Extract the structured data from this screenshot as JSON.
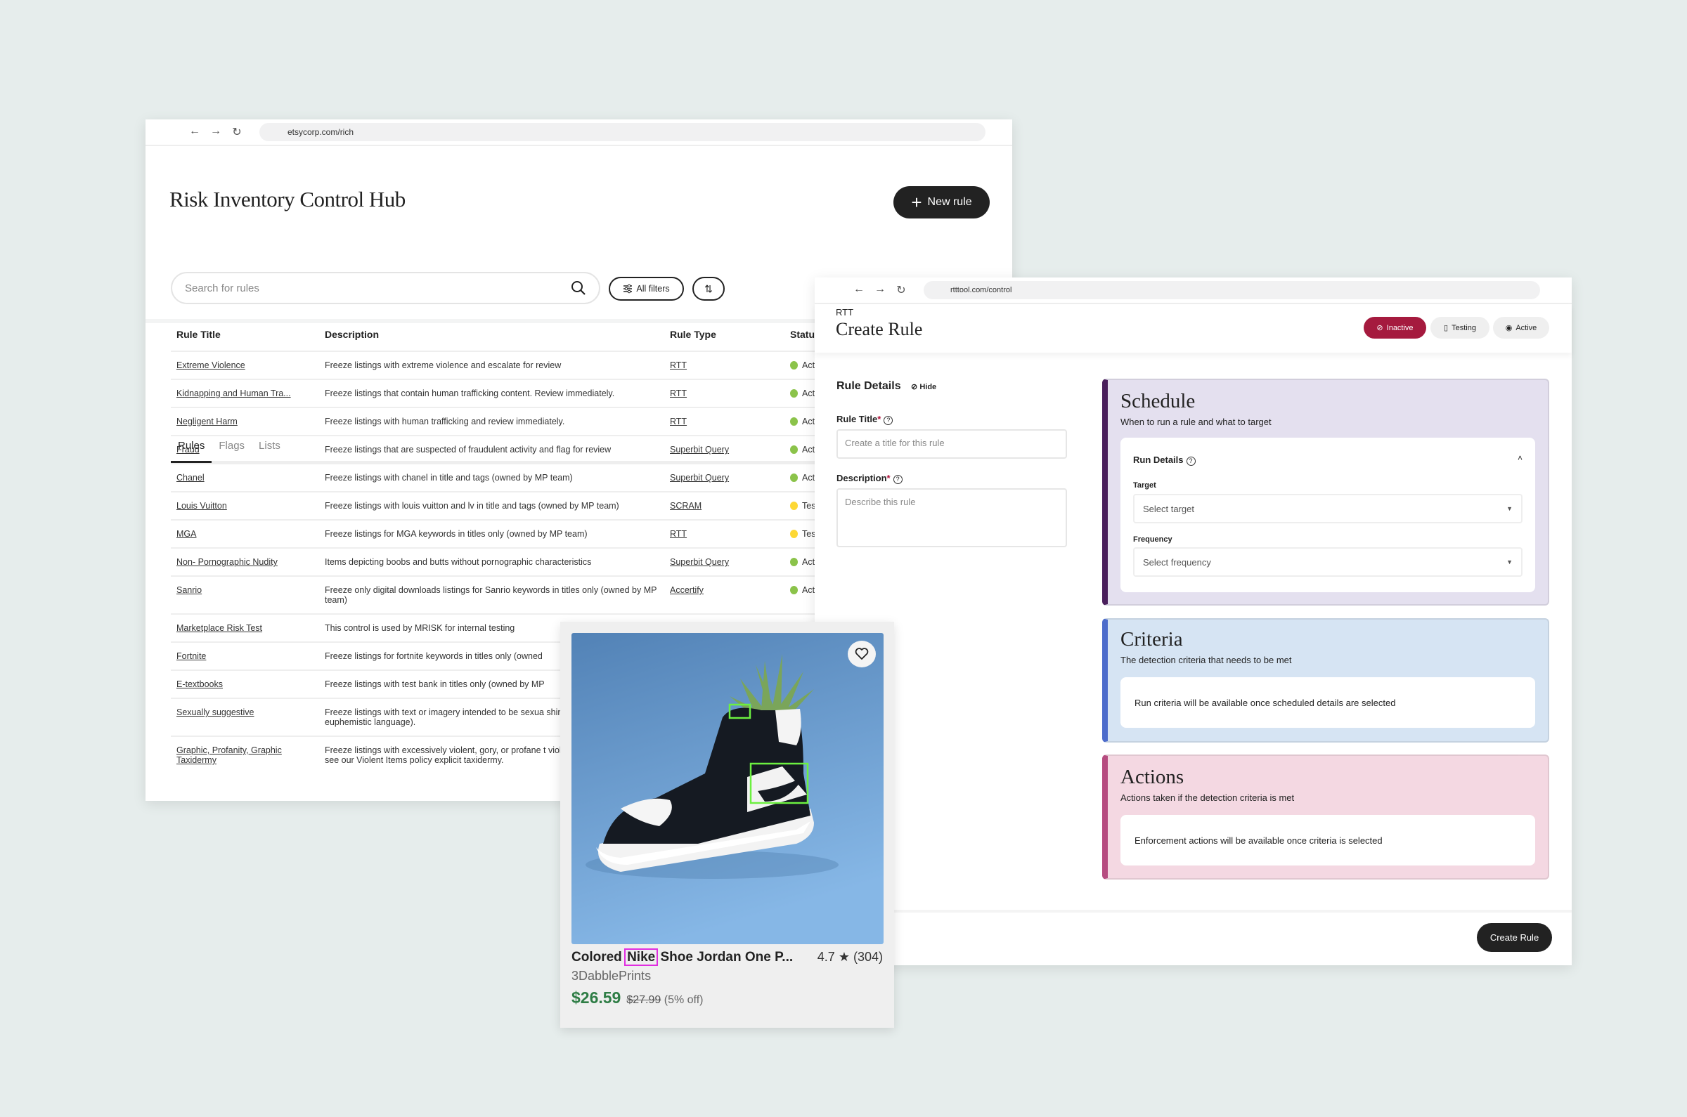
{
  "hub": {
    "url": "etsycorp.com/rich",
    "title": "Risk Inventory Control Hub",
    "new_rule_label": "New rule",
    "tabs": [
      {
        "label": "Rules",
        "active": true
      },
      {
        "label": "Flags",
        "active": false
      },
      {
        "label": "Lists",
        "active": false
      }
    ],
    "search_placeholder": "Search for rules",
    "all_filters_label": "All filters",
    "columns": [
      "Rule Title",
      "Description",
      "Rule Type",
      "Status"
    ],
    "status_colors": {
      "Active": "#8bc34a",
      "Testing": "#fdd835"
    },
    "rows": [
      {
        "title": "Extreme Violence",
        "description": "Freeze listings with extreme violence and escalate for review",
        "type": "RTT",
        "status": "Active"
      },
      {
        "title": "Kidnapping and Human Tra...",
        "description": "Freeze listings that contain human trafficking content. Review immediately.",
        "type": "RTT",
        "status": "Active"
      },
      {
        "title": "Negligent Harm",
        "description": "Freeze listings with human trafficking and review immediately.",
        "type": "RTT",
        "status": "Active"
      },
      {
        "title": "Fraud",
        "description": "Freeze listings that are suspected of fraudulent activity and flag for review",
        "type": "Superbit Query",
        "status": "Active"
      },
      {
        "title": "Chanel",
        "description": "Freeze listings with chanel in title and tags (owned by MP team)",
        "type": "Superbit Query",
        "status": "Active"
      },
      {
        "title": "Louis Vuitton",
        "description": "Freeze listings with louis vuitton and lv in title and tags (owned by MP team)",
        "type": "SCRAM",
        "status": "Testing"
      },
      {
        "title": "MGA",
        "description": "Freeze listings for MGA keywords in titles only (owned by MP team)",
        "type": "RTT",
        "status": "Testing"
      },
      {
        "title": "Non- Pornographic Nudity",
        "description": "Items depicting boobs and butts without pornographic characteristics",
        "type": "Superbit Query",
        "status": "Active"
      },
      {
        "title": "Sanrio",
        "description": "Freeze only digital downloads listings for Sanrio keywords in titles only (owned by MP team)",
        "type": "Accertify",
        "status": "Active"
      },
      {
        "title": "Marketplace Risk Test",
        "description": "This control is used by MRISK for internal testing",
        "type": "",
        "status": ""
      },
      {
        "title": "Fortnite",
        "description": "Freeze listings for fortnite keywords in titles only (owned",
        "type": "",
        "status": ""
      },
      {
        "title": "E-textbooks",
        "description": "Freeze listings with test bank in titles only (owned by MP",
        "type": "",
        "status": ""
      },
      {
        "title": "Sexually suggestive",
        "description": "Freeze listings with text or imagery intended to be sexua shirt with sexually euphemistic language).",
        "type": "",
        "status": ""
      },
      {
        "title": "Graphic, Profanity, Graphic Taxidermy",
        "description": "Freeze listings with excessively violent, gory, or profane t violent items are prohibited - see our Violent Items policy explicit taxidermy.",
        "type": "",
        "status": ""
      }
    ]
  },
  "rtt": {
    "url": "rtttool.com/control",
    "eyebrow": "RTT",
    "title": "Create Rule",
    "status_options": [
      {
        "label": "Inactive",
        "selected": true,
        "icon": "eye-off-icon"
      },
      {
        "label": "Testing",
        "selected": false,
        "icon": "beaker-icon"
      },
      {
        "label": "Active",
        "selected": false,
        "icon": "eye-icon"
      }
    ],
    "accent": "#a51a3e",
    "rule_details": {
      "heading": "Rule Details",
      "hide_label": "Hide",
      "rule_title_label": "Rule Title",
      "rule_title_placeholder": "Create a title for this rule",
      "description_label": "Description",
      "description_placeholder": "Describe this rule"
    },
    "schedule": {
      "title": "Schedule",
      "subtitle": "When to run a rule and what to target",
      "run_details_label": "Run Details",
      "target_label": "Target",
      "target_value": "Select target",
      "frequency_label": "Frequency",
      "frequency_value": "Select frequency",
      "color": "#e4e0ef",
      "accent": "#4a1f5c"
    },
    "criteria": {
      "title": "Criteria",
      "subtitle": "The detection criteria that needs to be met",
      "message": "Run criteria will be available once scheduled details are selected",
      "color": "#d6e4f3",
      "accent": "#4d6ccb"
    },
    "actions": {
      "title": "Actions",
      "subtitle": "Actions taken if the detection criteria is met",
      "message": "Enforcement actions will be available once criteria is selected",
      "color": "#f4d8e2",
      "accent": "#b64c80"
    },
    "create_label": "Create Rule"
  },
  "product": {
    "title_before": "Colored",
    "title_highlight": "Nike",
    "title_after": "Shoe Jordan One P...",
    "rating": "4.7",
    "reviews": "(304)",
    "shop": "3DabblePrints",
    "price": "$26.59",
    "original_price": "$27.99",
    "discount": "(5% off)",
    "highlight_color": "#e02ee0",
    "detection_box_color": "#6cf040"
  }
}
